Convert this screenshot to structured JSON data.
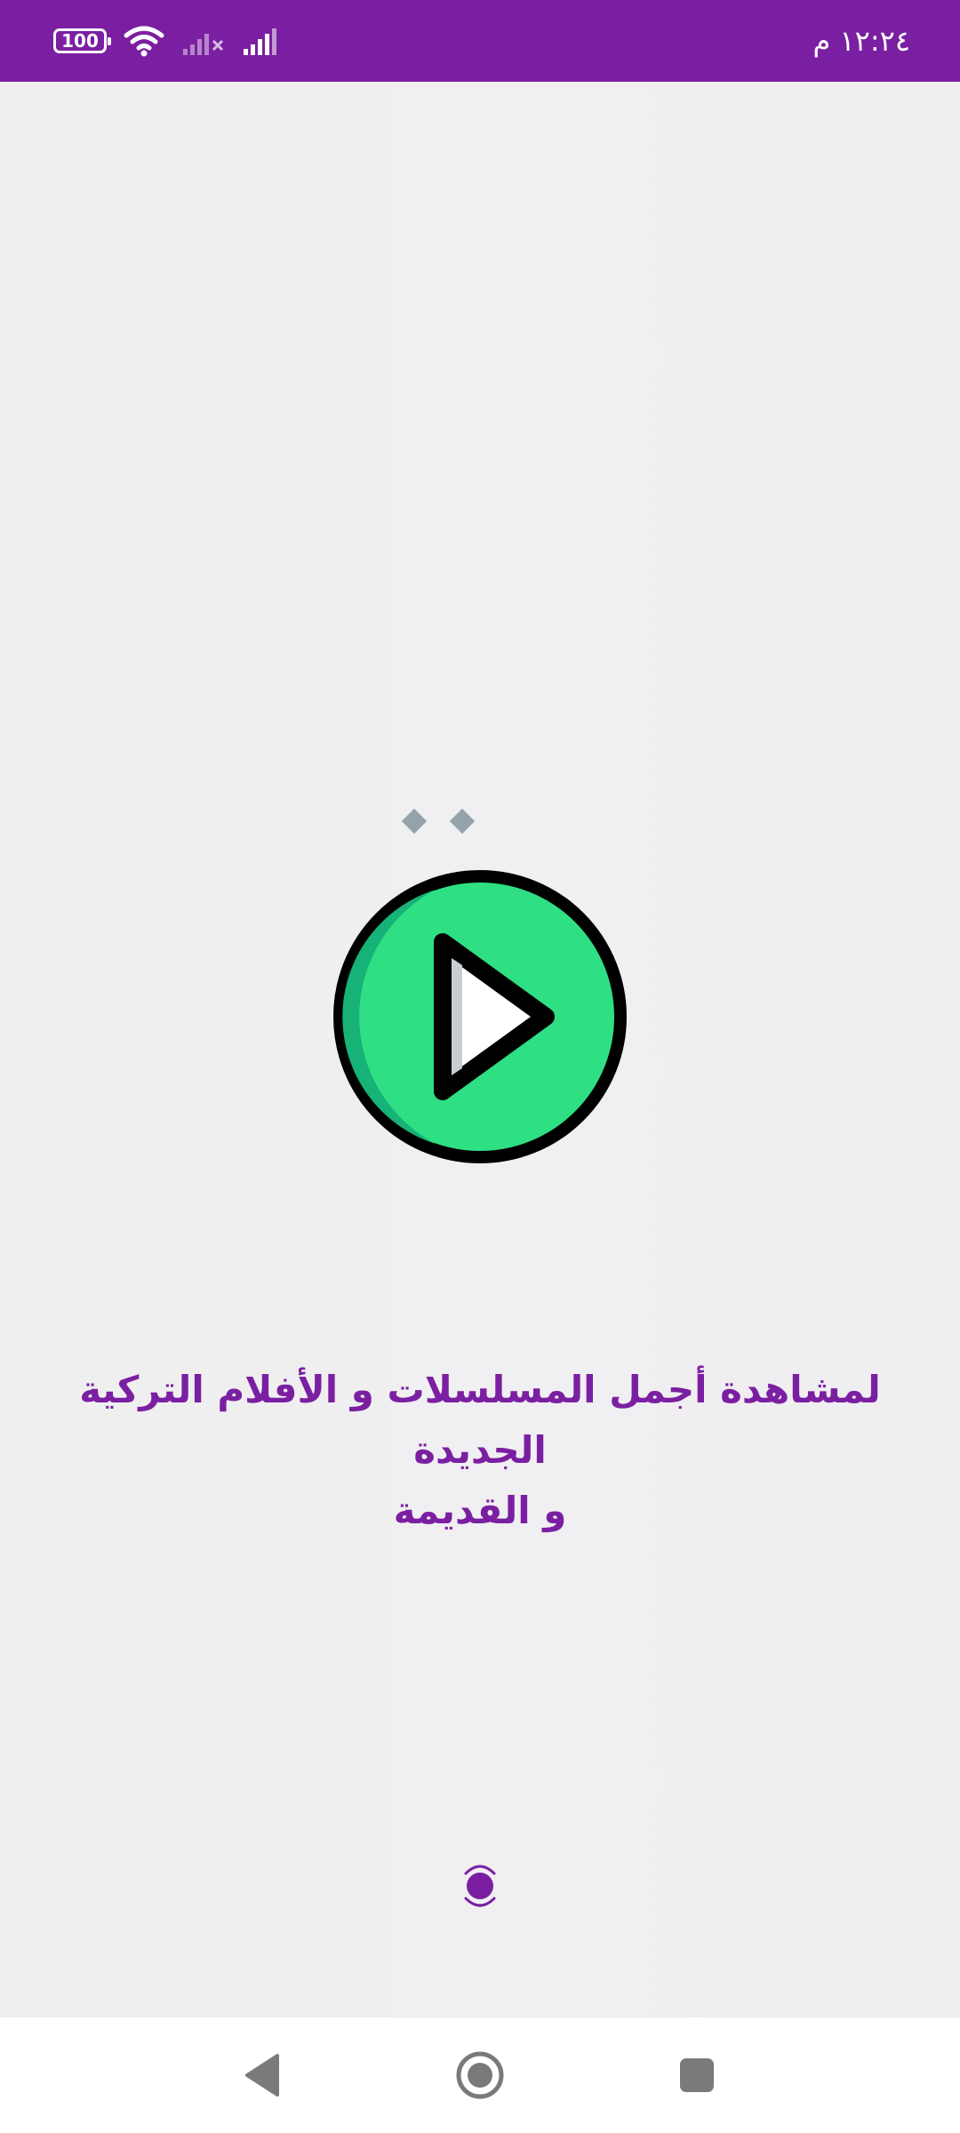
{
  "status_bar": {
    "time": "١٢:٢٤ م",
    "battery": "100",
    "background_color": "#7b1fa2",
    "icons": [
      "battery-icon",
      "wifi-icon",
      "signal-no-service-icon",
      "signal-icon"
    ]
  },
  "splash": {
    "logo_icon": "tv-play-icon",
    "tagline_line1": "لمشاهدة أجمل المسلسلات و الأفلام التركية الجديدة",
    "tagline_line2": "و القديمة",
    "accent_color": "#7b1fa2",
    "logo_color": "#2ee083"
  },
  "loader": {
    "icon": "loading-spinner-icon"
  },
  "nav_bar": {
    "buttons": [
      "back-icon",
      "home-icon",
      "recents-icon"
    ]
  }
}
